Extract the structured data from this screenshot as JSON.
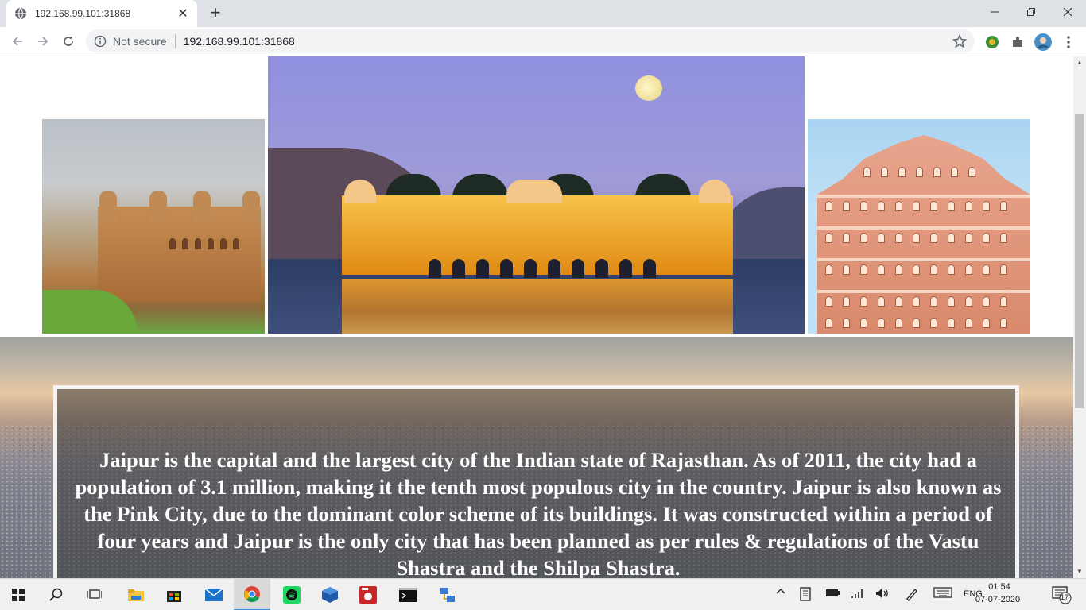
{
  "browser": {
    "tab_title": "192.168.99.101:31868",
    "security_label": "Not secure",
    "url": "192.168.99.101:31868",
    "window_controls": [
      "minimize-icon",
      "restore-icon",
      "close-icon"
    ]
  },
  "page": {
    "images": [
      {
        "name": "amber-fort-photo",
        "subject": "Amber Fort"
      },
      {
        "name": "jal-mahal-photo",
        "subject": "Jal Mahal"
      },
      {
        "name": "hawa-mahal-photo",
        "subject": "Hawa Mahal"
      }
    ],
    "description": "Jaipur is the capital and the largest city of the Indian state of Rajasthan. As of 2011, the city had a population of 3.1 million, making it the tenth most populous city in the country. Jaipur is also known as the Pink City, due to the dominant color scheme of its buildings. It was constructed within a period of four years and Jaipur is the only city that has been planned as per rules & regulations of the Vastu Shastra and the Shilpa Shastra."
  },
  "taskbar": {
    "language": "ENG",
    "time": "01:54",
    "date": "07-07-2020",
    "notification_count": "17",
    "apps": [
      "start-icon",
      "search-icon",
      "task-view-icon",
      "file-explorer-icon",
      "store-icon",
      "mail-icon",
      "chrome-icon",
      "spotify-icon",
      "virtualbox-icon",
      "app-icon",
      "terminal-icon",
      "network-app-icon"
    ]
  },
  "colors": {
    "tabstrip": "#dee1e6",
    "text_box_border": "#f2f2f2",
    "text": "#ffffff"
  }
}
